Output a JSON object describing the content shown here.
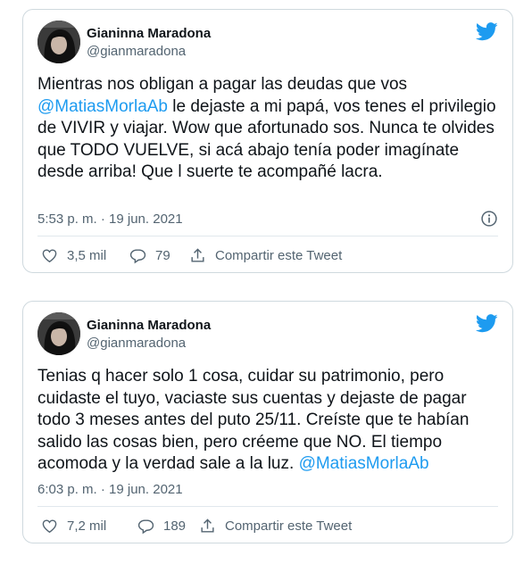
{
  "tweets": [
    {
      "author": {
        "name": "Gianinna Maradona",
        "handle": "@gianmaradona"
      },
      "text_line1_a": "Mientras nos obligan a pagar las deudas que vos ",
      "mention": "@MatiasMorlaAb",
      "text_line2_b": " le dejaste a mi papá, vos tenes el privilegio de VIVIR y viajar. Wow que afortunado sos. Nunca te olvides que TODO VUELVE, si acá abajo tenía poder imagínate desde arriba! Que l suerte te acompañé lacra.",
      "timestamp": "5:53 p. m. · 19 jun. 2021",
      "likes": "3,5 mil",
      "replies": "79",
      "share_label": "Compartir este Tweet"
    },
    {
      "author": {
        "name": "Gianinna Maradona",
        "handle": "@gianmaradona"
      },
      "text_a": "Tenias q hacer solo 1 cosa, cuidar su patrimonio, pero cuidaste el tuyo, vaciaste sus cuentas y dejaste de pagar todo 3 meses antes del puto 25/11. Creíste que te habían salido las cosas bien, pero créeme que NO. El tiempo acomoda y la verdad sale a la luz. ",
      "mention": "@MatiasMorlaAb",
      "timestamp": "6:03 p. m. · 19 jun. 2021",
      "likes": "7,2 mil",
      "replies": "189",
      "share_label": "Compartir este Tweet"
    }
  ],
  "colors": {
    "accent": "#1d9bf0",
    "secondary_text": "#536471",
    "border": "#cfd9de"
  },
  "icons": [
    "twitter-bird-icon",
    "info-icon",
    "heart-icon",
    "reply-bubble-icon",
    "share-icon"
  ]
}
